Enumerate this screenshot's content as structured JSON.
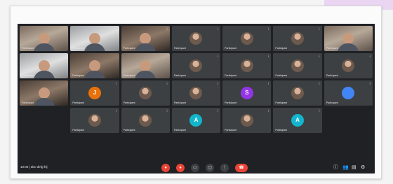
{
  "meeting": {
    "time_label": "10:05 | abc-defg-hij",
    "colors": {
      "background": "#202124",
      "tile": "#3c4043",
      "danger": "#ea4335"
    }
  },
  "tiles": [
    {
      "kind": "video",
      "name": "Participant",
      "muted": false
    },
    {
      "kind": "video",
      "name": "Participant",
      "muted": false
    },
    {
      "kind": "video",
      "name": "Participant",
      "muted": true
    },
    {
      "kind": "photo",
      "name": "Participant",
      "muted": true
    },
    {
      "kind": "photo",
      "name": "Participant",
      "muted": true
    },
    {
      "kind": "photo",
      "name": "Participant",
      "muted": true
    },
    {
      "kind": "video",
      "name": "Participant",
      "muted": false
    },
    {
      "kind": "video",
      "name": "Participant",
      "muted": false
    },
    {
      "kind": "video",
      "name": "Participant",
      "muted": false
    },
    {
      "kind": "video",
      "name": "Participant",
      "muted": false
    },
    {
      "kind": "photo",
      "name": "Participant",
      "muted": true
    },
    {
      "kind": "photo",
      "name": "Participant",
      "muted": true
    },
    {
      "kind": "photo",
      "name": "Participant",
      "muted": true
    },
    {
      "kind": "photo",
      "name": "Participant",
      "muted": true
    },
    {
      "kind": "video",
      "name": "Participant",
      "muted": false
    },
    {
      "kind": "letter",
      "letter": "J",
      "color": "#e8710a",
      "name": "Participant",
      "muted": true
    },
    {
      "kind": "photo",
      "name": "Participant",
      "muted": true
    },
    {
      "kind": "photo",
      "name": "Participant",
      "muted": true
    },
    {
      "kind": "letter",
      "letter": "S",
      "color": "#9334e6",
      "name": "Participant",
      "muted": true
    },
    {
      "kind": "photo",
      "name": "Participant",
      "muted": true
    },
    {
      "kind": "letter",
      "letter": "",
      "color": "#4285f4",
      "name": "Participant",
      "muted": true
    },
    {
      "kind": "empty"
    },
    {
      "kind": "photo",
      "name": "Participant",
      "muted": true
    },
    {
      "kind": "photo",
      "name": "Participant",
      "muted": true
    },
    {
      "kind": "letter",
      "letter": "A",
      "color": "#12b5cb",
      "name": "Participant",
      "muted": true
    },
    {
      "kind": "photo",
      "name": "Participant",
      "muted": true
    },
    {
      "kind": "letter",
      "letter": "A",
      "color": "#12b5cb",
      "name": "Participant",
      "muted": true
    },
    {
      "kind": "empty"
    },
    {
      "kind": "empty"
    },
    {
      "kind": "empty"
    },
    {
      "kind": "empty"
    },
    {
      "kind": "empty"
    },
    {
      "kind": "empty"
    },
    {
      "kind": "empty"
    },
    {
      "kind": "empty"
    }
  ],
  "controls": [
    {
      "icon": "mic-off-icon",
      "glyph": "●",
      "style": "red"
    },
    {
      "icon": "camera-off-icon",
      "glyph": "●",
      "style": "red"
    },
    {
      "icon": "captions-icon",
      "glyph": "▭",
      "style": "grey"
    },
    {
      "icon": "present-icon",
      "glyph": "▢",
      "style": "grey"
    },
    {
      "icon": "more-options-icon",
      "glyph": "⋮",
      "style": "grey"
    },
    {
      "icon": "end-call-icon",
      "glyph": "☎",
      "style": "end"
    }
  ],
  "right_controls": [
    {
      "icon": "info-icon",
      "glyph": "ⓘ"
    },
    {
      "icon": "people-icon",
      "glyph": "👥"
    },
    {
      "icon": "chat-icon",
      "glyph": "▤"
    },
    {
      "icon": "activities-icon",
      "glyph": "⚙"
    }
  ]
}
